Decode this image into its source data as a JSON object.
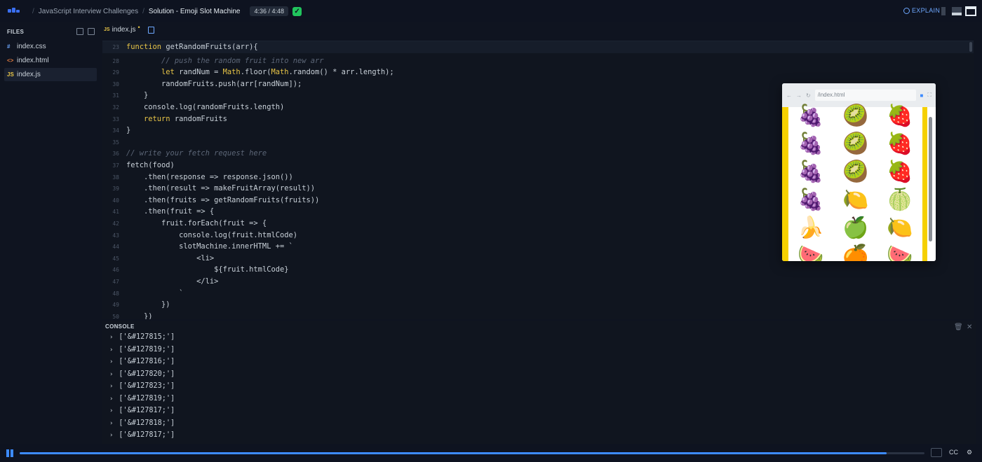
{
  "header": {
    "breadcrumb_course": "JavaScript Interview Challenges",
    "breadcrumb_lesson": "Solution - Emoji Slot Machine",
    "time": "4:36 / 4:48",
    "explain_label": "EXPLAIN"
  },
  "sidebar": {
    "title": "FILES",
    "files": [
      {
        "icon": "#",
        "name": "index.css",
        "icon_color": "#6ea8ff"
      },
      {
        "icon": "<>",
        "name": "index.html",
        "icon_color": "#e07a3f"
      },
      {
        "icon": "JS",
        "name": "index.js",
        "icon_color": "#e8c547"
      }
    ]
  },
  "editor": {
    "tab_label": "index.js",
    "tab_icon": "JS",
    "lines": [
      {
        "n": "23",
        "html": "<span class='kw'>function</span> <span class='tx'>getRandomFruits(arr){</span>"
      },
      {
        "n": "28",
        "html": "        <span class='cm'>// push the random fruit into new arr</span>"
      },
      {
        "n": "29",
        "html": "        <span class='kw'>let</span> <span class='tx'>randNum = </span><span class='pr'>Math</span><span class='tx'>.floor(</span><span class='pr'>Math</span><span class='tx'>.random() * arr.length);</span>"
      },
      {
        "n": "30",
        "html": "        <span class='tx'>randomFruits.push(arr[randNum]);</span>"
      },
      {
        "n": "31",
        "html": "    <span class='tx'>}</span>"
      },
      {
        "n": "32",
        "html": "    <span class='tx'>console.log(randomFruits.length)</span>"
      },
      {
        "n": "33",
        "html": "    <span class='kw'>return</span> <span class='tx'>randomFruits</span>"
      },
      {
        "n": "34",
        "html": "<span class='tx'>}</span>"
      },
      {
        "n": "35",
        "html": ""
      },
      {
        "n": "36",
        "html": "<span class='cm'>// write your fetch request here</span>"
      },
      {
        "n": "37",
        "html": "<span class='tx'>fetch(food)</span>"
      },
      {
        "n": "38",
        "html": "    <span class='tx'>.then(response =&gt; response.json())</span>"
      },
      {
        "n": "39",
        "html": "    <span class='tx'>.then(result =&gt; makeFruitArray(result))</span>"
      },
      {
        "n": "40",
        "html": "    <span class='tx'>.then(fruits =&gt; getRandomFruits(fruits))</span>"
      },
      {
        "n": "41",
        "html": "    <span class='tx'>.then(fruit =&gt; {</span>"
      },
      {
        "n": "42",
        "html": "        <span class='tx'>fruit.forEach(fruit =&gt; {</span>"
      },
      {
        "n": "43",
        "html": "            <span class='tx'>console.log(fruit.htmlCode)</span>"
      },
      {
        "n": "44",
        "html": "            <span class='tx'>slotMachine.innerHTML += `</span>"
      },
      {
        "n": "45",
        "html": "                <span class='tx'>&lt;li&gt;</span>"
      },
      {
        "n": "46",
        "html": "                    <span class='tx'>${fruit.htmlCode}</span>"
      },
      {
        "n": "47",
        "html": "                <span class='tx'>&lt;/li&gt;</span>"
      },
      {
        "n": "48",
        "html": "            <span class='tx'>`</span>"
      },
      {
        "n": "49",
        "html": "        <span class='tx'>})</span>"
      },
      {
        "n": "50",
        "html": "    <span class='tx'>})</span>"
      }
    ]
  },
  "preview": {
    "url": "/index.html",
    "rows": [
      [
        "🍇",
        "🥝",
        "🍓"
      ],
      [
        "🍇",
        "🥝",
        "🍓"
      ],
      [
        "🍇",
        "🥝",
        "🍓"
      ],
      [
        "🍇",
        "🍋",
        "🍈"
      ],
      [
        "🍌",
        "🍏",
        "🍋"
      ],
      [
        "🍉",
        "🍊",
        "🍉"
      ]
    ]
  },
  "console": {
    "title": "CONSOLE",
    "logs": [
      "['&#127815;']",
      "['&#127819;']",
      "['&#127816;']",
      "['&#127820;']",
      "['&#127823;']",
      "['&#127819;']",
      "['&#127817;']",
      "['&#127818;']",
      "['&#127817;']"
    ]
  },
  "player": {
    "progress": 0.958,
    "cc_label": "CC"
  },
  "colors": {
    "accent": "#3d8bff",
    "keyword": "#e8c547",
    "comment": "#5c6677",
    "success": "#21c55d",
    "preview_border": "#f5d000"
  }
}
